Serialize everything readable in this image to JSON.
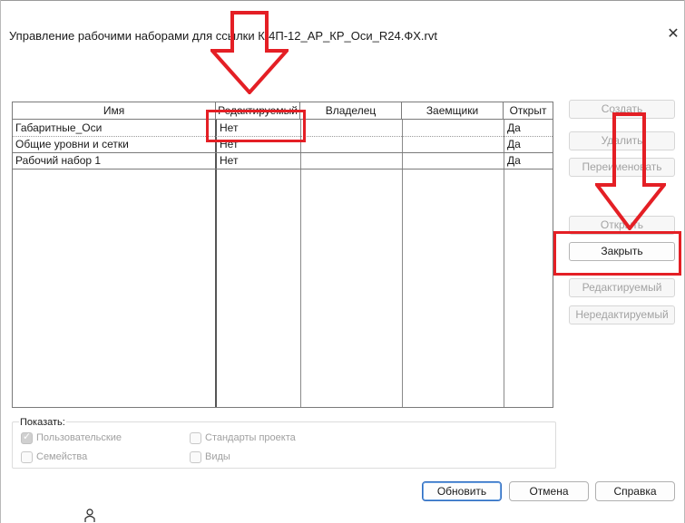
{
  "window": {
    "title": "Управление рабочими наборами для ссылки К-4П-12_АР_КР_Оси_R24.ФХ.rvt",
    "close_glyph": "✕"
  },
  "table": {
    "columns": [
      "Имя",
      "Редактируемый",
      "Владелец",
      "Заемщики",
      "Открыт"
    ],
    "rows": [
      {
        "name": "Габаритные_Оси",
        "editable": "Нет",
        "owner": "",
        "borrowers": "",
        "open": "Да"
      },
      {
        "name": "Общие уровни и сетки",
        "editable": "Нет",
        "owner": "",
        "borrowers": "",
        "open": "Да"
      },
      {
        "name": "Рабочий набор 1",
        "editable": "Нет",
        "owner": "",
        "borrowers": "",
        "open": "Да"
      }
    ]
  },
  "side_buttons": {
    "create": "Создать",
    "delete": "Удалить",
    "rename": "Переименовать",
    "open": "Открыть",
    "close": "Закрыть",
    "editable": "Редактируемый",
    "non_editable": "Нередактируемый"
  },
  "show": {
    "label": "Показать:",
    "user_defined": "Пользовательские",
    "user_defined_checked": true,
    "families": "Семейства",
    "families_checked": false,
    "project_standards": "Стандарты проекта",
    "project_standards_checked": false,
    "views": "Виды",
    "views_checked": false
  },
  "bottom_buttons": {
    "update": "Обновить",
    "cancel": "Отмена",
    "help": "Справка"
  },
  "annotation_color": "#e41f25",
  "icons": {
    "close": "close-icon",
    "arrow": "red-arrow-down-icon",
    "person": "person-icon"
  }
}
